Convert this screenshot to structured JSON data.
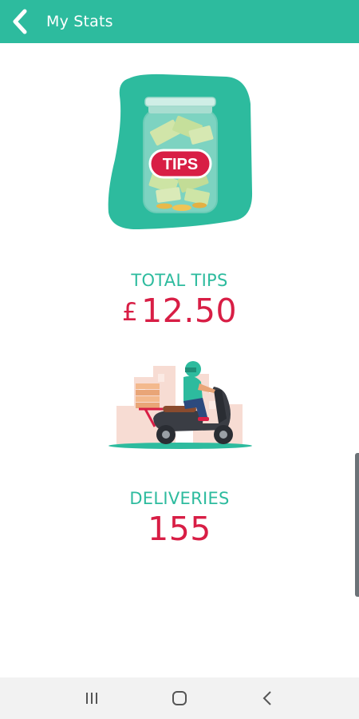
{
  "header": {
    "title": "My Stats",
    "back_icon": "chevron-left-icon",
    "background": "#2dbb9e"
  },
  "tips_illustration": {
    "icon": "tips-jar-illustration",
    "jar_label": "TIPS"
  },
  "total_tips": {
    "label": "TOTAL TIPS",
    "currency": "£",
    "amount": "12.50"
  },
  "delivery_illustration": {
    "icon": "scooter-delivery-illustration"
  },
  "deliveries": {
    "label": "DELIVERIES",
    "count": "155"
  },
  "system_nav": {
    "recents_icon": "recents-icon",
    "home_icon": "home-icon",
    "back_icon": "back-icon"
  },
  "colors": {
    "accent": "#2dbb9e",
    "value": "#d81e45"
  }
}
